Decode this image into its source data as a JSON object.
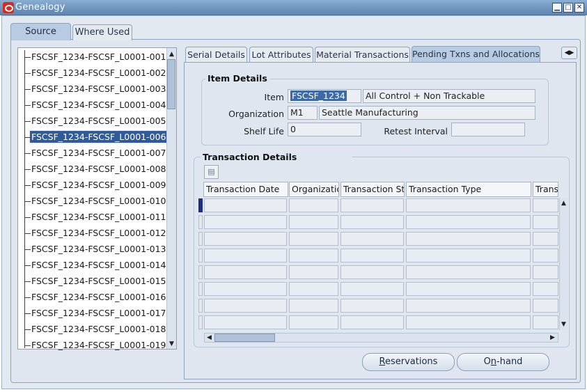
{
  "window": {
    "title": "Genealogy",
    "min_label": "▁",
    "max_label": "□",
    "close_label": "✕"
  },
  "main_tabs": [
    {
      "label": "Source"
    },
    {
      "label": "Where Used"
    }
  ],
  "tree": {
    "items": [
      "FSCSF_1234-FSCSF_L0001-001",
      "FSCSF_1234-FSCSF_L0001-002",
      "FSCSF_1234-FSCSF_L0001-003",
      "FSCSF_1234-FSCSF_L0001-004",
      "FSCSF_1234-FSCSF_L0001-005",
      "FSCSF_1234-FSCSF_L0001-006",
      "FSCSF_1234-FSCSF_L0001-007",
      "FSCSF_1234-FSCSF_L0001-008",
      "FSCSF_1234-FSCSF_L0001-009",
      "FSCSF_1234-FSCSF_L0001-010",
      "FSCSF_1234-FSCSF_L0001-011",
      "FSCSF_1234-FSCSF_L0001-012",
      "FSCSF_1234-FSCSF_L0001-013",
      "FSCSF_1234-FSCSF_L0001-014",
      "FSCSF_1234-FSCSF_L0001-015",
      "FSCSF_1234-FSCSF_L0001-016",
      "FSCSF_1234-FSCSF_L0001-017",
      "FSCSF_1234-FSCSF_L0001-018",
      "FSCSF_1234-FSCSF_L0001-019"
    ],
    "selected_item": "FSCSF_1234-FSCSF_L0001-006"
  },
  "detail_tabs": [
    {
      "label": "Serial Details"
    },
    {
      "label": "Lot Attributes"
    },
    {
      "label": "Material Transactions"
    },
    {
      "label": "Pending Txns and Allocations"
    }
  ],
  "item_details": {
    "title": "Item Details",
    "item_label": "Item",
    "item_value": "FSCSF_1234",
    "item_desc": "All Control + Non Trackable",
    "org_label": "Organization",
    "org_code": "M1",
    "org_name": "Seattle Manufacturing",
    "shelf_label": "Shelf Life",
    "shelf_value": "0",
    "retest_label": "Retest Interval",
    "retest_value": ""
  },
  "transaction_details": {
    "title": "Transaction Details",
    "columns": [
      "Transaction Date",
      "Organization",
      "Transaction Status",
      "Transaction Type",
      "Transaction"
    ]
  },
  "buttons": {
    "reservations_u": "R",
    "reservations_rest": "eservations",
    "onhand_pre": "O",
    "onhand_u": "n",
    "onhand_rest": "-hand"
  },
  "icons": {
    "scroll_up": "▲",
    "scroll_down": "▼",
    "scroll_left": "◀",
    "scroll_right": "▶",
    "folder": "folder-open-icon"
  }
}
